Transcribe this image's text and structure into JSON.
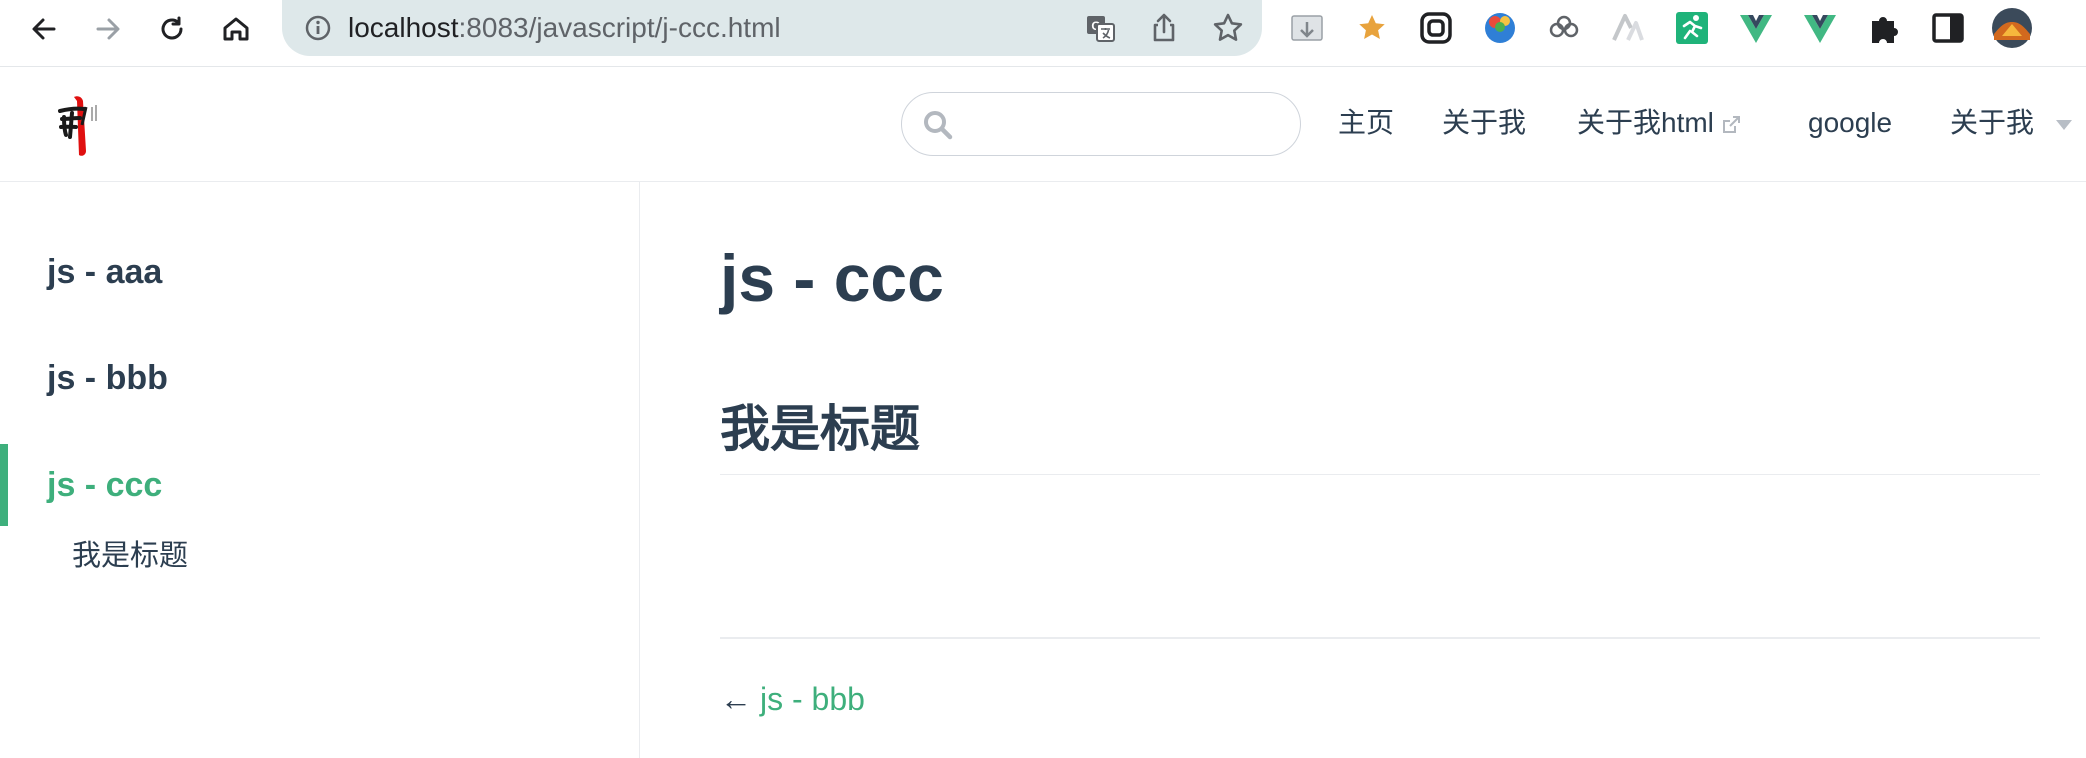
{
  "browser": {
    "url_host": "localhost",
    "url_rest": ":8083/javascript/j-ccc.html"
  },
  "site": {
    "search": {
      "placeholder": ""
    },
    "nav": [
      {
        "label": "主页"
      },
      {
        "label": "关于我"
      },
      {
        "label": "关于我html"
      },
      {
        "label": "google"
      },
      {
        "label": "关于我"
      }
    ]
  },
  "sidebar": {
    "items": [
      {
        "label": "js - aaa"
      },
      {
        "label": "js - bbb"
      },
      {
        "label": "js - ccc"
      }
    ],
    "sub_items": [
      {
        "label": "我是标题"
      }
    ]
  },
  "content": {
    "title": "js - ccc",
    "heading": "我是标题",
    "prev": {
      "arrow": "←",
      "label": "js - bbb"
    }
  },
  "colors": {
    "accent": "#3eaf7c",
    "text": "#2c3e50",
    "border": "#eaecef",
    "omnibox": "#dee8ea"
  }
}
